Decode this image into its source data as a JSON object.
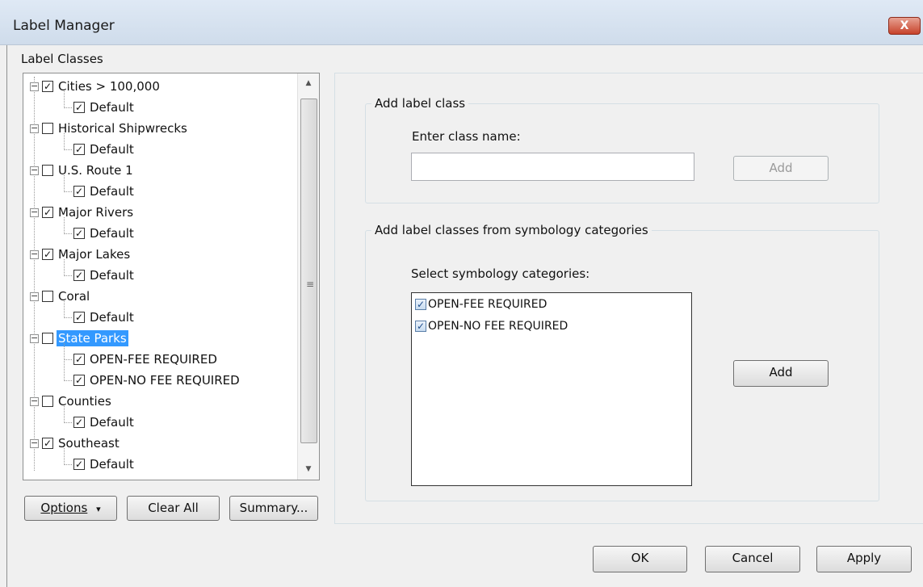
{
  "window": {
    "title": "Label Manager",
    "close_glyph": "X"
  },
  "label_classes_heading": "Label Classes",
  "tree": [
    {
      "label": "Cities > 100,000",
      "checked": true,
      "children": [
        {
          "label": "Default",
          "checked": true
        }
      ]
    },
    {
      "label": "Historical Shipwrecks",
      "checked": false,
      "children": [
        {
          "label": "Default",
          "checked": true
        }
      ]
    },
    {
      "label": "U.S. Route 1",
      "checked": false,
      "children": [
        {
          "label": "Default",
          "checked": true
        }
      ]
    },
    {
      "label": "Major Rivers",
      "checked": true,
      "children": [
        {
          "label": "Default",
          "checked": true
        }
      ]
    },
    {
      "label": "Major Lakes",
      "checked": true,
      "children": [
        {
          "label": "Default",
          "checked": true
        }
      ]
    },
    {
      "label": "Coral",
      "checked": false,
      "children": [
        {
          "label": "Default",
          "checked": true
        }
      ]
    },
    {
      "label": "State Parks",
      "checked": false,
      "selected": true,
      "children": [
        {
          "label": "OPEN-FEE REQUIRED",
          "checked": true
        },
        {
          "label": "OPEN-NO FEE REQUIRED",
          "checked": true
        }
      ]
    },
    {
      "label": "Counties",
      "checked": false,
      "children": [
        {
          "label": "Default",
          "checked": true
        }
      ]
    },
    {
      "label": "Southeast",
      "checked": true,
      "children": [
        {
          "label": "Default",
          "checked": true
        }
      ]
    }
  ],
  "left_buttons": {
    "options": "Options",
    "options_arrow": "▾",
    "clear_all": "Clear All",
    "summary": "Summary..."
  },
  "add_label_class": {
    "group_title": "Add label class",
    "prompt": "Enter class name:",
    "input_value": "",
    "add_button": "Add"
  },
  "add_from_symbology": {
    "group_title": "Add label classes from symbology categories",
    "prompt": "Select symbology categories:",
    "categories": [
      {
        "label": "OPEN-FEE REQUIRED",
        "checked": true
      },
      {
        "label": "OPEN-NO FEE REQUIRED",
        "checked": true
      }
    ],
    "add_button": "Add"
  },
  "footer": {
    "ok": "OK",
    "cancel": "Cancel",
    "apply": "Apply"
  },
  "glyphs": {
    "check": "✓",
    "minus": "−",
    "scroll_up": "▲",
    "scroll_down": "▼",
    "grip": "≡"
  }
}
